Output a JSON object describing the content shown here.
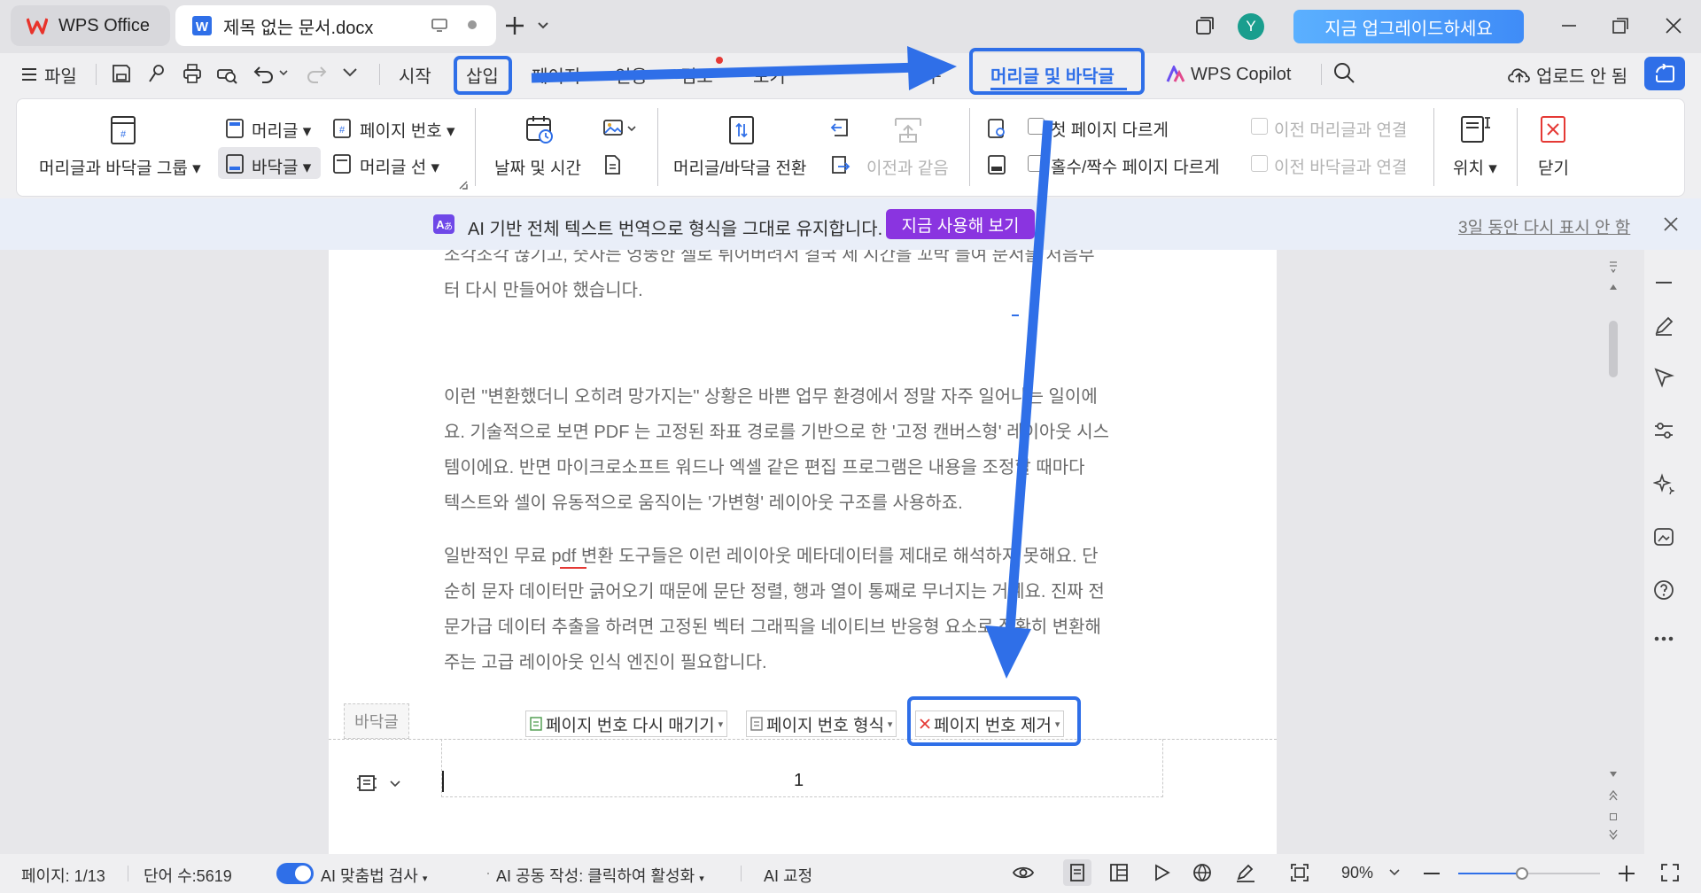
{
  "tabs": [
    {
      "label": "WPS Office",
      "icon": "wps-logo-icon"
    },
    {
      "label": "제목 없는 문서.docx",
      "icon": "word-doc-icon"
    }
  ],
  "titlebar": {
    "avatar": "Y",
    "upgrade": "지금 업그레이드하세요"
  },
  "menu": {
    "file": "파일",
    "items": [
      "시작",
      "삽입",
      "페이지",
      "인용",
      "검토",
      "보기",
      "도구",
      "머리글 및 바닥글"
    ],
    "copilot": "WPS Copilot",
    "upload": "업로드 안 됨"
  },
  "ribbon": {
    "group": "머리글과 바닥글 그룹",
    "header": "머리글",
    "footer": "바닥글",
    "page_number": "페이지 번호",
    "header_line": "머리글 선",
    "date_time": "날짜 및 시간",
    "switch": "머리글/바닥글 전환",
    "same_as_prev": "이전과 같음",
    "first_page": "첫 페이지 다르게",
    "odd_even": "홀수/짝수 페이지 다르게",
    "link_prev_header": "이전 머리글과 연결",
    "link_prev_footer": "이전 바닥글과 연결",
    "position": "위치",
    "close": "닫기"
  },
  "banner": {
    "text": "AI 기반 전체 텍스트 번역으로 형식을 그대로 유지합니다.",
    "button": "지금 사용해 보기",
    "dismiss": "3일 동안 다시 표시 안 함"
  },
  "document": {
    "lines_top": [
      "조각조각 끊기고, 숫자는 엉뚱한 셀로 튀어버려서 결국 세 시간을 꼬박 들여 문서를 처음부",
      "터 다시 만들어야 했습니다."
    ],
    "para1": [
      "이런 \"변환했더니 오히려 망가지는\" 상황은 바쁜 업무 환경에서 정말 자주 일어나는 일이에",
      "요. 기술적으로 보면 PDF 는 고정된 좌표 경로를 기반으로 한 '고정 캔버스형' 레이아웃 시스",
      "템이에요. 반면 마이크로소프트 워드나 엑셀 같은 편집 프로그램은 내용을 조정할 때마다",
      "텍스트와 셀이 유동적으로 움직이는 '가변형' 레이아웃 구조를 사용하죠."
    ],
    "para2": [
      "일반적인 무료 pdf 변환 도구들은 이런 레이아웃 메타데이터를 제대로 해석하지 못해요. 단",
      "순히 문자 데이터만 긁어오기 때문에 문단 정렬, 행과 열이 통째로 무너지는 거예요. 진짜 전",
      "문가급 데이터 추출을 하려면 고정된 벡터 그래픽을 네이티브 반응형 요소로 정확히 변환해",
      "주는 고급 레이아웃 인식 엔진이 필요합니다."
    ],
    "footer_tag": "바닥글",
    "footer_tools": [
      "페이지 번호 다시 매기기",
      "페이지 번호 형식",
      "페이지 번호 제거"
    ],
    "footer_page_number": "1"
  },
  "status": {
    "page": "페이지: 1/13",
    "words": "단어 수:5619",
    "spell": "AI 맞춤법 검사",
    "ai_write": "AI 공동 작성: 클릭하여 활성화",
    "ai_proof": "AI 교정",
    "zoom": "90%"
  },
  "colors": {
    "highlight": "#2f6fe8",
    "accent": "#3f8cf7",
    "banner_button": "#8a34e0"
  }
}
